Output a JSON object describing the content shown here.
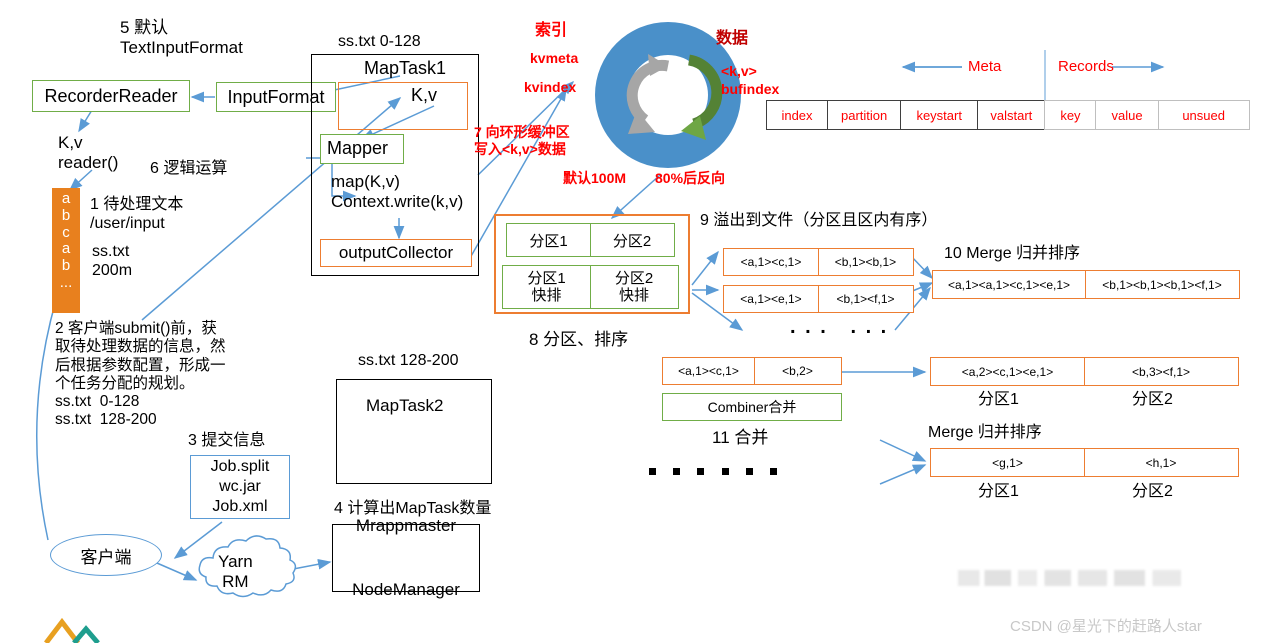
{
  "diagram": {
    "title_watermark": "CSDN @星光下的赶路人star",
    "steps": {
      "s1": "1 待处理文本\n/user/input",
      "s1b": "ss.txt\n200m",
      "s2": "2 客户端submit()前，获\n取待处理数据的信息，然\n后根据参数配置，形成一\n个任务分配的规划。\nss.txt  0-128\nss.txt  128-200",
      "s3": "3 提交信息",
      "s4": "4 计算出MapTask数量",
      "s5": "5 默认\nTextInputFormat",
      "s6": "6 逻辑运算",
      "s7": "7 向环形缓冲区\n写入<k,v>数据",
      "s8": "8 分区、排序",
      "s9": "9 溢出到文件（分区且区内有序）",
      "s10": "10 Merge 归并排序",
      "s11": "11 合并",
      "merge2": "Merge 归并排序"
    },
    "boxes": {
      "recorder_reader": "RecorderReader",
      "input_format": "InputFormat",
      "kv": "K,v",
      "mapper": "Mapper",
      "output_collector": "outputCollector",
      "maptask1": "MapTask1",
      "maptask2": "MapTask2",
      "job_files": "Job.split\nwc.jar\nJob.xml",
      "mrappmaster": "Mrappmaster\n\nNodeManager",
      "client": "客户端",
      "yarn": "Yarn\nRM",
      "combiner": "Combiner合并"
    },
    "labels": {
      "ss_txt_0_128": "ss.txt 0-128",
      "ss_txt_128_200": "ss.txt 128-200",
      "kv_reader": "K,v\nreader()",
      "map_context": "map(K,v)\nContext.write(k,v)"
    },
    "ring": {
      "index_title": "索引",
      "kvmeta": "kvmeta",
      "kvindex": "kvindex",
      "data_title": "数据",
      "kv": "<k,v>",
      "bufindex": "bufindex",
      "default_size": "默认100M",
      "reverse": "80%后反向"
    },
    "meta_table": {
      "meta_arrow_label": "Meta",
      "records_arrow_label": "Records",
      "meta_cells": [
        "index",
        "partition",
        "keystart",
        "valstart"
      ],
      "record_cells": [
        "key",
        "value",
        "unsued"
      ]
    },
    "partition_box": {
      "row1": [
        "分区1",
        "分区2"
      ],
      "row2": [
        "分区1\n快排",
        "分区2\n快排"
      ]
    },
    "spill_files": [
      {
        "left": "<a,1><c,1>",
        "right": "<b,1><b,1>"
      },
      {
        "left": "<a,1><e,1>",
        "right": "<b,1><f,1>"
      }
    ],
    "merge_row": {
      "left": "<a,1><a,1><c,1><e,1>",
      "right": "<b,1><b,1><b,1><f,1>"
    },
    "combine_row": {
      "left": "<a,1><c,1>",
      "right": "<b,2>"
    },
    "final_rows": [
      {
        "left": "<a,2><c,1><e,1>",
        "right": "<b,3><f,1>",
        "left_cap": "分区1",
        "right_cap": "分区2"
      },
      {
        "left": "<g,1>",
        "right": "<h,1>",
        "left_cap": "分区1",
        "right_cap": "分区2"
      }
    ],
    "split_letters": [
      "a",
      "b",
      "c",
      "a",
      "b",
      "..."
    ],
    "dots_label": ". . .   . . .",
    "colors": {
      "green": "#70AD47",
      "orange": "#ED7D31",
      "blue": "#5B9BD5",
      "red": "#FF0000",
      "dark_red": "#C00000",
      "split_fill": "#E8801E",
      "ring_blue": "#4A90C9",
      "ring_gray": "#A6A6A6",
      "ring_green": "#548235"
    }
  }
}
